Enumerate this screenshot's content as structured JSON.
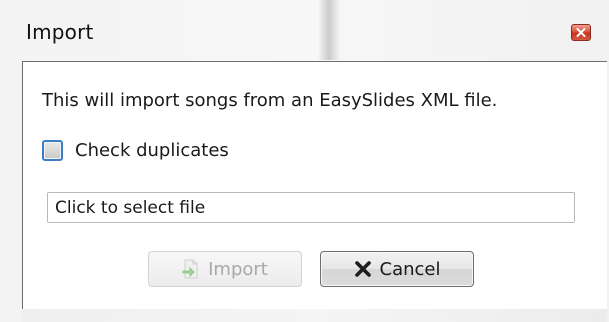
{
  "window": {
    "title": "Import"
  },
  "dialog": {
    "description": "This will import songs from an EasySlides XML file.",
    "check_duplicates": {
      "label": "Check duplicates",
      "checked": false
    },
    "file_field": {
      "placeholder": "Click to select file"
    },
    "buttons": {
      "import_label": "Import",
      "import_enabled": false,
      "import_icon": "import-icon",
      "cancel_label": "Cancel",
      "cancel_icon": "close-x-icon"
    }
  },
  "colors": {
    "close_button": "#d0432a",
    "checkbox_border": "#3a7fc4",
    "disabled_text": "#a8a8a8"
  }
}
